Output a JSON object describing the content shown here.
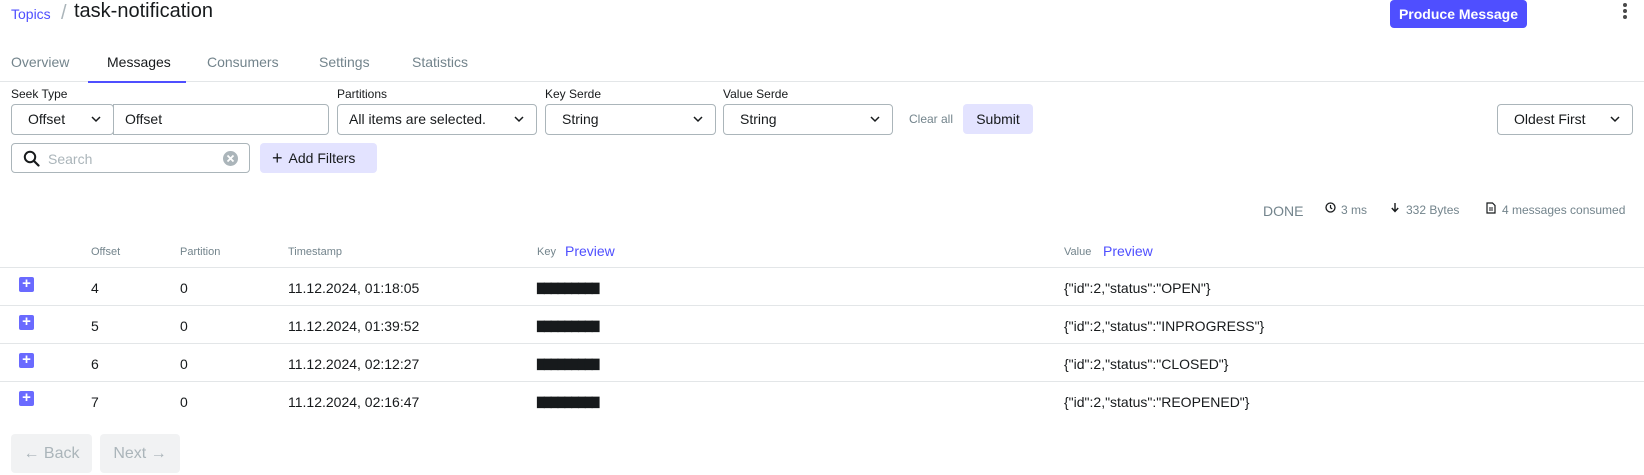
{
  "breadcrumb": {
    "link": "Topics",
    "separator": "/",
    "title": "task-notification"
  },
  "header": {
    "produce_button": "Produce Message"
  },
  "tabs": [
    {
      "label": "Overview"
    },
    {
      "label": "Messages",
      "active": true
    },
    {
      "label": "Consumers"
    },
    {
      "label": "Settings"
    },
    {
      "label": "Statistics"
    }
  ],
  "filters": {
    "seek_type_label": "Seek Type",
    "seek_type_value": "Offset",
    "offset_value": "Offset",
    "partitions_label": "Partitions",
    "partitions_value": "All items are selected.",
    "key_serde_label": "Key Serde",
    "key_serde_value": "String",
    "value_serde_label": "Value Serde",
    "value_serde_value": "String",
    "clear_all": "Clear all",
    "submit": "Submit",
    "sort_value": "Oldest First",
    "search_placeholder": "Search",
    "add_filters": "Add Filters"
  },
  "stats": {
    "status": "DONE",
    "elapsed": "3 ms",
    "bytes": "332 Bytes",
    "consumed": "4 messages consumed"
  },
  "table": {
    "columns": {
      "offset": "Offset",
      "partition": "Partition",
      "timestamp": "Timestamp",
      "key": "Key",
      "value": "Value",
      "preview": "Preview"
    },
    "rows": [
      {
        "offset": "4",
        "partition": "0",
        "timestamp": "11.12.2024, 01:18:05",
        "key": "▆▆▆▆▆▆▆▆▆",
        "value": "{\"id\":2,\"status\":\"OPEN\"}"
      },
      {
        "offset": "5",
        "partition": "0",
        "timestamp": "11.12.2024, 01:39:52",
        "key": "▆▆▆▆▆▆▆▆▆",
        "value": "{\"id\":2,\"status\":\"INPROGRESS\"}"
      },
      {
        "offset": "6",
        "partition": "0",
        "timestamp": "11.12.2024, 02:12:27",
        "key": "▆▆▆▆▆▆▆▆▆",
        "value": "{\"id\":2,\"status\":\"CLOSED\"}"
      },
      {
        "offset": "7",
        "partition": "0",
        "timestamp": "11.12.2024, 02:16:47",
        "key": "▆▆▆▆▆▆▆▆▆",
        "value": "{\"id\":2,\"status\":\"REOPENED\"}"
      }
    ]
  },
  "pager": {
    "back": "← Back",
    "next": "Next →"
  },
  "colors": {
    "accent": "#4F4FFF",
    "accent_light": "#E3E3FF",
    "muted": "#73848C"
  }
}
